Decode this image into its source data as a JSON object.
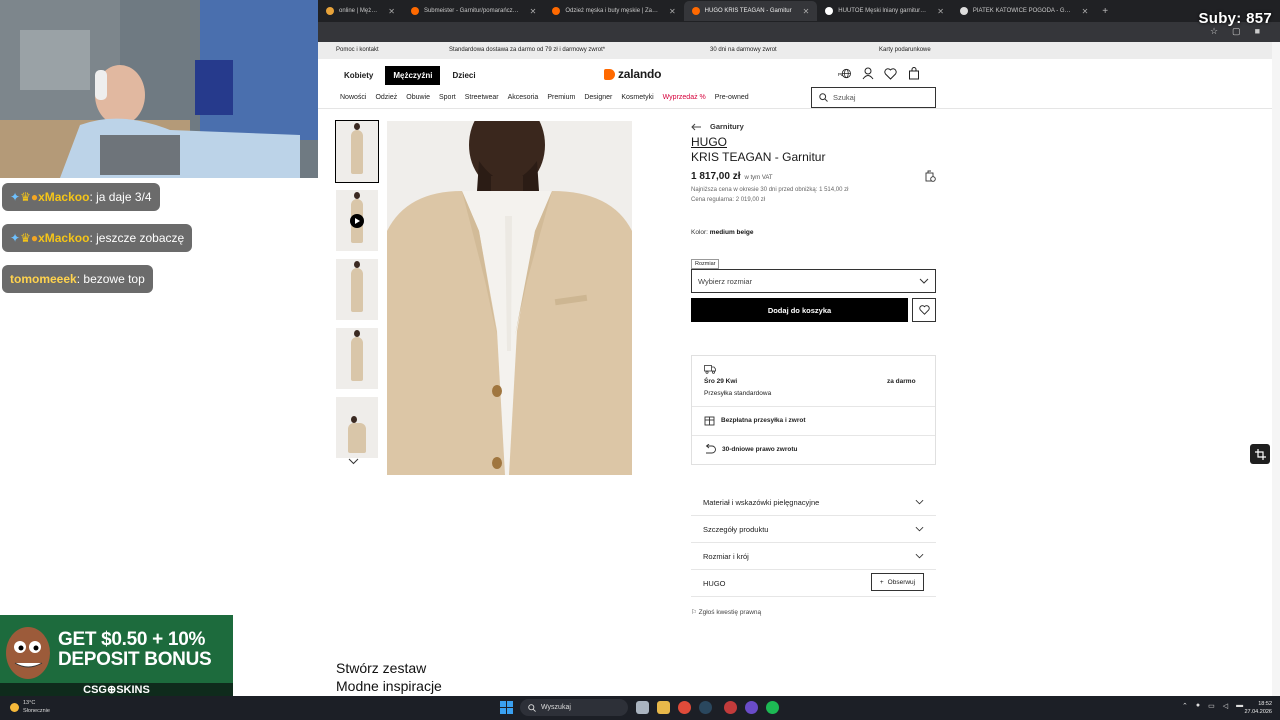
{
  "browser": {
    "tabs": [
      {
        "label": "online | Męż…",
        "fav": "#e8a33a",
        "active": false
      },
      {
        "label": "Submeister - Garnitur/pomarańcz…",
        "fav": "#ff6900",
        "active": false
      },
      {
        "label": "Odzież męska i buty męskie | Za…",
        "fav": "#ff6900",
        "active": false
      },
      {
        "label": "HUGO KRIS TEAGAN - Garnitur",
        "fav": "#ff6900",
        "active": true
      },
      {
        "label": "HUUTOE Męski lniany garnitur…",
        "fav": "#ffffff",
        "active": false
      },
      {
        "label": "PIATEK KATOWICE POGODA - G…",
        "fav": "#dddddd",
        "active": false
      }
    ],
    "new_tab": "+"
  },
  "overlay": {
    "subs": "Suby: 857",
    "chat": [
      {
        "user": "xMackoo",
        "sep": ":",
        "msg": "ja daje 3/4",
        "user_color": "#f5c518"
      },
      {
        "user": "xMackoo",
        "sep": ":",
        "msg": "jeszcze zobaczę",
        "user_color": "#f5c518"
      },
      {
        "user": "tomomeeek",
        "sep": ":",
        "msg": "bezowe top",
        "user_color": "#ffd34e"
      }
    ],
    "ad": {
      "line1": "GET $0.50 + 10%",
      "line2": "DEPOSIT BONUS",
      "brand": "CSG⊕SKINS"
    }
  },
  "promo": {
    "help": "Pomoc i kontakt",
    "shipping": "Standardowa dostawa za darmo od 79 zł i darmowy zwrot*",
    "returns": "30 dni na darmowy zwrot",
    "gift": "Karty podarunkowe"
  },
  "header": {
    "tabs": [
      {
        "label": "Kobiety",
        "active": false
      },
      {
        "label": "Mężczyźni",
        "active": true
      },
      {
        "label": "Dzieci",
        "active": false
      }
    ],
    "logo": "zalando",
    "lang": "PL",
    "nav": [
      "Nowości",
      "Odzież",
      "Obuwie",
      "Sport",
      "Streetwear",
      "Akcesoria",
      "Premium",
      "Designer",
      "Kosmetyki",
      "Wyprzedaż %",
      "Pre-owned"
    ],
    "search_placeholder": "Szukaj"
  },
  "product": {
    "breadcrumb": "Garnitury",
    "brand": "HUGO",
    "name": "KRIS TEAGAN - Garnitur",
    "price": "1 817,00 zł",
    "vat": "w tym VAT",
    "lowest": "Najniższa cena w okresie 30 dni przed obniżką: 1 514,00 zł",
    "regular": "Cena regularna: 2 019,00 zł",
    "color_label": "Kolor:",
    "color_value": "medium beige",
    "size_label": "Rozmiar",
    "size_placeholder": "Wybierz rozmiar",
    "add_to_cart": "Dodaj do koszyka",
    "delivery_date": "Śro 29 Kwi",
    "delivery_price": "za darmo",
    "delivery_type": "Przesyłka standardowa",
    "free_shipping": "Bezpłatna przesyłka i zwrot",
    "return_policy": "30-dniowe prawo zwrotu",
    "accordions": [
      "Materiał i wskazówki pielęgnacyjne",
      "Szczegóły produktu",
      "Rozmiar i krój"
    ],
    "brand_row": "HUGO",
    "follow": "Obserwuj",
    "report": "Zgłoś kwestię prawną"
  },
  "sections": {
    "outfit": "Stwórz zestaw",
    "inspiration": "Modne inspiracje"
  },
  "taskbar": {
    "temp": "13°C",
    "weather": "Słonecznie",
    "search": "Wyszukaj",
    "time": "18:52",
    "date": "27.04.2026"
  },
  "colors": {
    "accent": "#ff6900",
    "sale": "#d6003b",
    "chat_bg": "#6b6b6b"
  }
}
